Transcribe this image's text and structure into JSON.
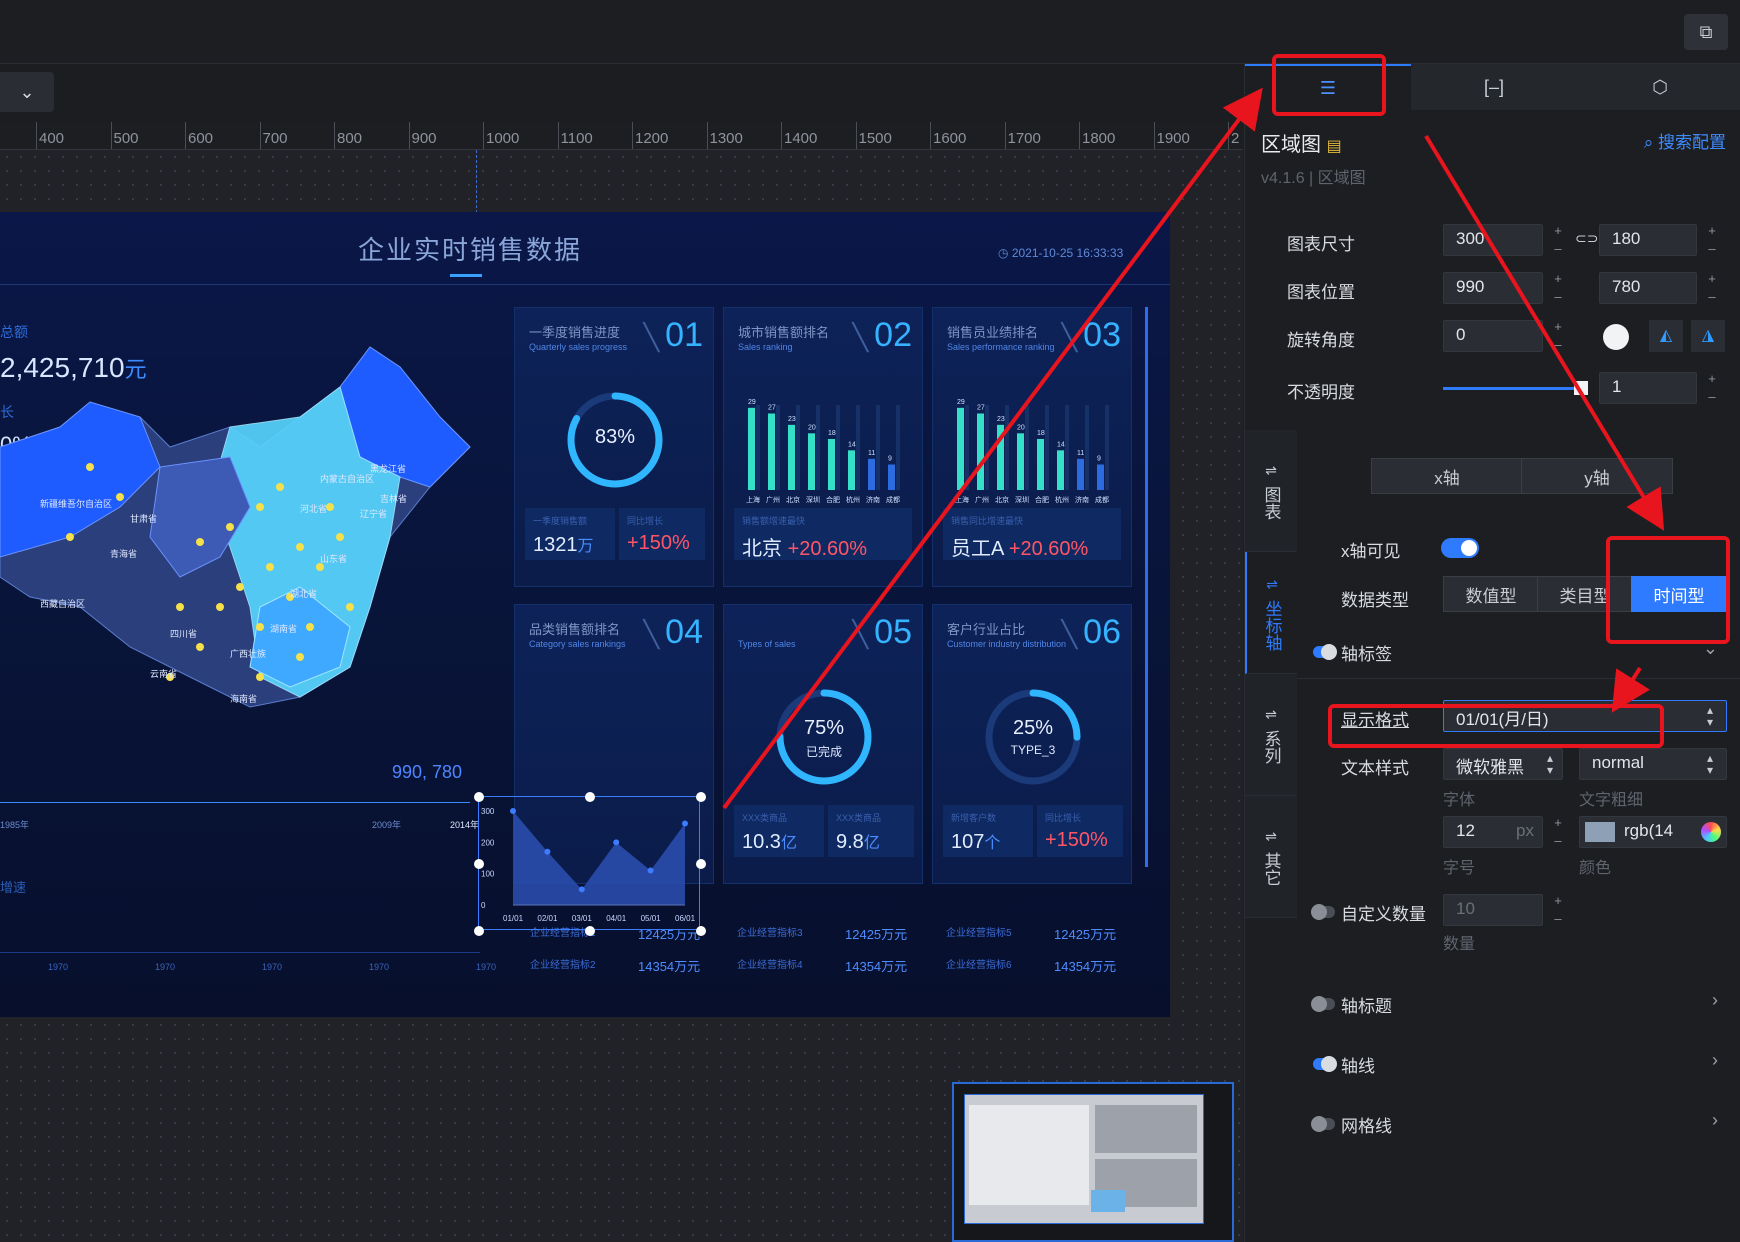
{
  "toolbar": {
    "export_icon": "clipboard-icon"
  },
  "ruler": {
    "labels": [
      "400",
      "500",
      "600",
      "700",
      "800",
      "900",
      "1000",
      "1100",
      "1200",
      "1300",
      "1400",
      "1500",
      "1600",
      "1700",
      "1800",
      "1900",
      "2"
    ]
  },
  "screen": {
    "title": "企业实时销售数据",
    "timestamp": "2021-10-25 16:33:33",
    "left_label": "总额",
    "amount": "2,425,710",
    "amount_unit": "元",
    "left_label2": "长",
    "percent": "0%",
    "coord_readout": "990, 780",
    "timeline_left": "1985年",
    "timeline_mid": "2009年",
    "timeline_right": "2014年",
    "bottom_left_label": "增速",
    "bottom_years": [
      "1970",
      "1970",
      "1970",
      "1970",
      "1970"
    ],
    "provinces": [
      "新疆维吾尔自治区",
      "西藏自治区",
      "青海省",
      "甘肃省",
      "四川省",
      "云南省",
      "黑龙江省",
      "吉林省",
      "内蒙古自治区",
      "辽宁省",
      "河北省",
      "山东省",
      "湖北省",
      "湖南省",
      "广西壮族",
      "海南省"
    ],
    "cards": [
      {
        "title": "一季度销售进度",
        "subtitle": "Quarterly sales progress",
        "num": "01",
        "ring": "83%",
        "k1_label": "一季度销售额",
        "k1_value": "1321",
        "k1_unit": "万",
        "k2_label": "同比增长",
        "k2_value": "+150%"
      },
      {
        "title": "城市销售额排名",
        "subtitle": "Sales ranking",
        "num": "02",
        "k1_label": "销售额增速最快",
        "k1_value": "北京",
        "k1_red": "+20.60%",
        "bars": [
          29,
          27,
          23,
          20,
          18,
          14,
          11,
          9
        ],
        "cities": [
          "上海",
          "广州",
          "北京",
          "深圳",
          "合肥",
          "杭州",
          "济南",
          "成都"
        ]
      },
      {
        "title": "销售员业绩排名",
        "subtitle": "Sales performance ranking",
        "num": "03",
        "k1_label": "销售同比增速最快",
        "k1_value": "员工A",
        "k1_red": "+20.60%",
        "bars": [
          29,
          27,
          23,
          20,
          18,
          14,
          11,
          9
        ],
        "cities": [
          "上海",
          "广州",
          "北京",
          "深圳",
          "合肥",
          "杭州",
          "济南",
          "成都"
        ]
      },
      {
        "title": "品类销售额排名",
        "subtitle": "Category sales rankings",
        "num": "04"
      },
      {
        "title": "",
        "subtitle": "Types of sales",
        "num": "05",
        "ring": "75%",
        "ring_sub": "已完成",
        "k1_label": "XXX类商品",
        "k1_value": "10.3",
        "k1_unit": "亿",
        "k2_label": "XXX类商品",
        "k2_value": "9.8",
        "k2_unit": "亿"
      },
      {
        "title": "客户行业占比",
        "subtitle": "Customer industry distribution",
        "num": "06",
        "ring": "25%",
        "ring_sub": "TYPE_3",
        "k1_label": "新增客户数",
        "k1_value": "107",
        "k1_unit": "个",
        "k2_label": "同比增长",
        "k2_value": "+150%"
      }
    ],
    "rows": [
      {
        "a": "企业经营指标1",
        "b": "12425万元",
        "c": "企业经营指标3",
        "d": "12425万元",
        "e": "企业经营指标5",
        "f": "12425万元"
      },
      {
        "a": "企业经营指标2",
        "b": "14354万元",
        "c": "企业经营指标4",
        "d": "14354万元",
        "e": "企业经营指标6",
        "f": "14354万元"
      }
    ]
  },
  "chart_data": {
    "type": "area",
    "categories": [
      "01/01",
      "02/01",
      "03/01",
      "04/01",
      "05/01",
      "06/01"
    ],
    "values": [
      300,
      170,
      50,
      200,
      110,
      260
    ],
    "yticks": [
      "300",
      "200",
      "100",
      "0"
    ],
    "ylim": [
      0,
      300
    ],
    "title": "",
    "xlabel": "",
    "ylabel": ""
  },
  "panel": {
    "tabs": {
      "config_icon": "sliders-icon",
      "data_icon": "bracket-icon",
      "interaction_icon": "hexagon-icon"
    },
    "component_name": "区域图",
    "doc_icon": "document-icon",
    "search_config": "搜索配置",
    "version": "v4.1.6 | 区域图",
    "size_label": "图表尺寸",
    "width": "300",
    "height": "180",
    "pos_label": "图表位置",
    "x": "990",
    "y": "780",
    "rotate_label": "旋转角度",
    "rotate": "0",
    "opacity_label": "不透明度",
    "opacity": "1",
    "opacity_level": 1,
    "side_tabs": [
      {
        "label": "图表",
        "active": false
      },
      {
        "label": "坐标轴",
        "active": true
      },
      {
        "label": "系列",
        "active": false
      },
      {
        "label": "其它",
        "active": false
      }
    ],
    "axis_x": "x轴",
    "axis_y": "y轴",
    "x_visible_label": "x轴可见",
    "data_type_label": "数据类型",
    "data_types": [
      "数值型",
      "类目型",
      "时间型"
    ],
    "axis_label_label": "轴标签",
    "display_format_label": "显示格式",
    "display_format_value": "01/01(月/日)",
    "text_style_label": "文本样式",
    "font_value": "微软雅黑",
    "font_caption": "字体",
    "weight_value": "normal",
    "weight_caption": "文字粗细",
    "size_value": "12",
    "size_unit": "px",
    "size_caption": "字号",
    "color_value": "rgb(14",
    "color_caption": "颜色",
    "custom_count_label": "自定义数量",
    "custom_count_value": "10",
    "custom_count_caption": "数量",
    "axis_title_label": "轴标题",
    "axis_line_label": "轴线",
    "grid_line_label": "网格线"
  },
  "colors": {
    "accent": "#2f7bff",
    "annotation": "#e8141e",
    "screen_bg": "#0a1748"
  }
}
